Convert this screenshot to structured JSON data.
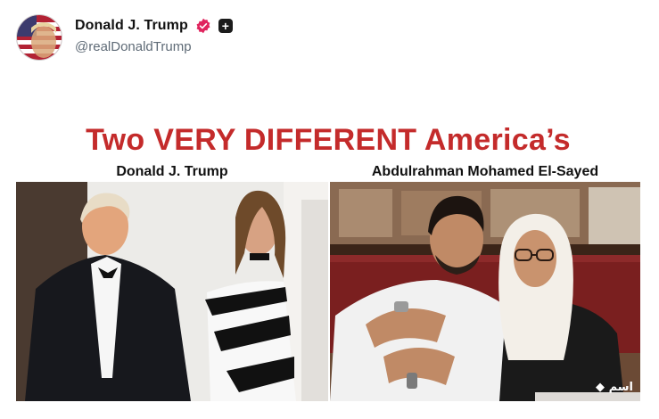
{
  "post": {
    "author_name": "Donald J. Trump",
    "handle": "@realDonaldTrump"
  },
  "meme": {
    "title": "Two VERY DIFFERENT America’s",
    "left_caption": "Donald J. Trump",
    "right_caption": "Abdulrahman Mohamed El-Sayed"
  },
  "icons": {
    "verified": "verified-badge-icon",
    "plus": "plus-badge-icon"
  },
  "colors": {
    "title_red": "#c42b2b",
    "verified_pink": "#e0245e",
    "handle_gray": "#5f6b77"
  }
}
